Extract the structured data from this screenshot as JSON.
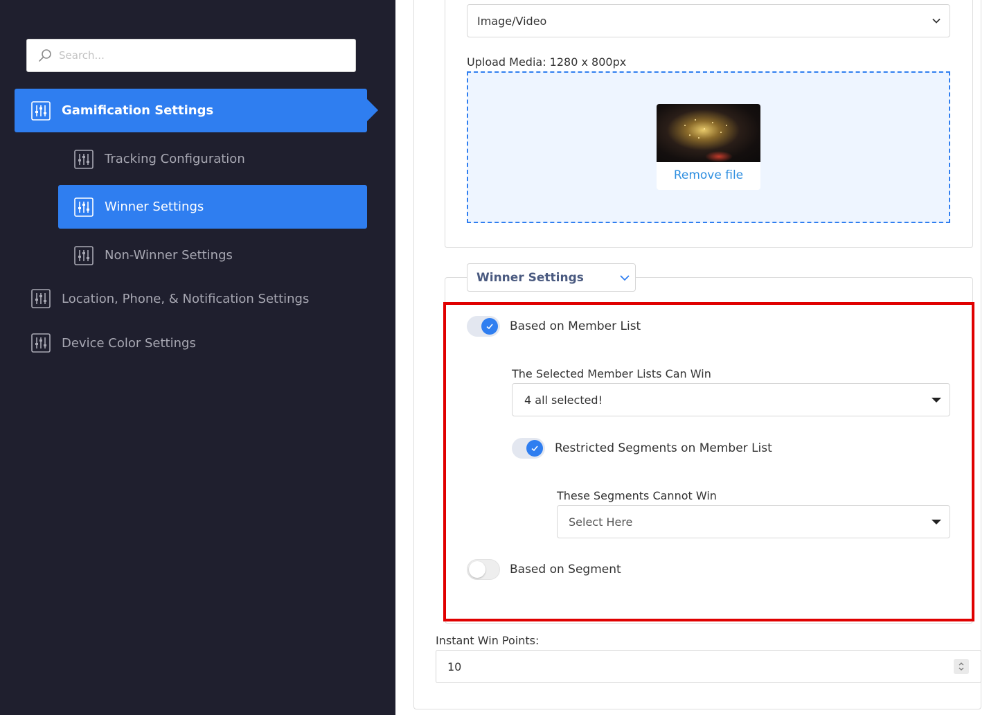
{
  "sidebar": {
    "search": {
      "placeholder": "Search..."
    },
    "items": [
      {
        "label": "Gamification Settings",
        "active": true
      },
      {
        "label": "Tracking Configuration",
        "active": false
      },
      {
        "label": "Winner Settings",
        "active": true
      },
      {
        "label": "Non-Winner Settings",
        "active": false
      },
      {
        "label": "Location, Phone, & Notification Settings",
        "active": false
      },
      {
        "label": "Device Color Settings",
        "active": false
      }
    ]
  },
  "media": {
    "type_select_value": "Image/Video",
    "upload_label": "Upload Media: 1280 x 800px",
    "remove_file": "Remove file"
  },
  "winner": {
    "tab_label": "Winner Settings",
    "member_list_toggle": {
      "label": "Based on Member List",
      "on": true
    },
    "member_lists_label": "The Selected Member Lists Can Win",
    "member_lists_value": "4 all selected!",
    "restricted_toggle": {
      "label": "Restricted Segments on Member List",
      "on": true
    },
    "segments_label": "These Segments Cannot Win",
    "segments_placeholder": "Select Here",
    "segment_toggle": {
      "label": "Based on Segment",
      "on": false
    }
  },
  "instant_win": {
    "label": "Instant Win Points:",
    "value": "10"
  },
  "colors": {
    "sidebar_bg": "#1f1f2e",
    "accent": "#2f7ef0",
    "highlight": "#e00000"
  }
}
